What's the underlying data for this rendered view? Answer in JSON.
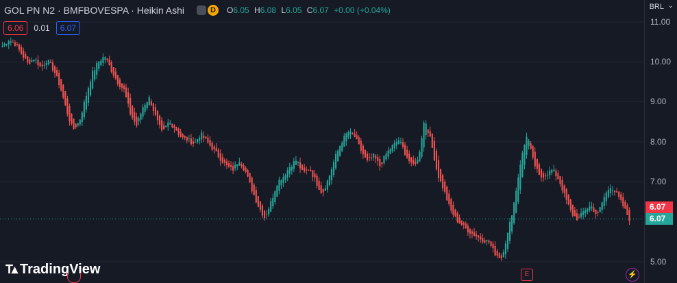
{
  "header": {
    "symbol_title": "GOL PN N2 · BMFBOVESPA · Heikin Ashi",
    "interval_badge": "D",
    "open_label": "O",
    "open_value": "6.05",
    "high_label": "H",
    "high_value": "6.08",
    "low_label": "L",
    "low_value": "6.05",
    "close_label": "C",
    "close_value": "6.07",
    "change": "+0.00 (+0.04%)"
  },
  "trade": {
    "sell_price": "6.06",
    "spread": "0.01",
    "buy_price": "6.07"
  },
  "axis": {
    "currency": "BRL",
    "ticks": [
      "11.00",
      "10.00",
      "9.00",
      "8.00",
      "7.00",
      "5.00"
    ],
    "last_price_red": "6.07",
    "last_price_green": "6.07"
  },
  "markers": {
    "earnings": "E",
    "dividend": "",
    "split": "⚡"
  },
  "branding": {
    "logo_text": "TradingView"
  },
  "colors": {
    "up": "#26a69a",
    "down": "#ef5350",
    "background": "#161a25",
    "grid": "#232733",
    "accent_orange": "#f7a600"
  },
  "chart_data": {
    "type": "candlestick",
    "style": "Heikin Ashi",
    "ylim": [
      4.85,
      11.2
    ],
    "yticks": [
      11.0,
      10.0,
      9.0,
      8.0,
      7.0,
      5.0
    ],
    "last_price": 6.07,
    "close_path": [
      10.4,
      10.55,
      10.45,
      10.2,
      9.95,
      10.1,
      9.85,
      10.05,
      9.8,
      9.4,
      8.8,
      8.3,
      8.5,
      9.1,
      9.7,
      10.0,
      10.15,
      9.8,
      9.5,
      9.3,
      8.7,
      8.4,
      8.9,
      9.1,
      8.6,
      8.2,
      8.5,
      8.35,
      8.1,
      8.05,
      7.95,
      8.2,
      8.0,
      7.8,
      7.6,
      7.4,
      7.3,
      7.55,
      7.25,
      6.8,
      6.4,
      6.1,
      6.5,
      7.0,
      7.15,
      7.4,
      7.55,
      7.2,
      7.35,
      7.0,
      6.7,
      7.1,
      7.6,
      8.0,
      8.25,
      8.15,
      7.8,
      7.5,
      7.65,
      7.4,
      7.7,
      7.9,
      8.05,
      7.7,
      7.4,
      7.55,
      8.6,
      8.0,
      7.2,
      6.8,
      6.3,
      6.05,
      5.9,
      5.75,
      5.65,
      5.55,
      5.5,
      5.2,
      5.1,
      5.7,
      6.5,
      7.5,
      8.2,
      7.5,
      7.1,
      7.2,
      7.3,
      7.05,
      6.6,
      6.2,
      6.05,
      6.3,
      6.4,
      6.15,
      6.6,
      6.9,
      6.7,
      6.4,
      6.07
    ],
    "n_candles": 300
  }
}
